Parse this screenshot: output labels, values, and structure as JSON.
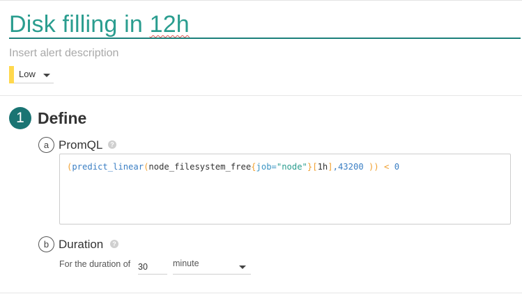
{
  "alert": {
    "title_prefix": "Disk filling in ",
    "title_misspelled": "12h",
    "description_placeholder": "Insert alert description",
    "severity": {
      "label": "Low",
      "color": "#ffd84d"
    }
  },
  "define": {
    "step_number": "1",
    "title": "Define",
    "promql": {
      "letter": "a",
      "title": "PromQL",
      "help_icon": "?",
      "query": "(predict_linear(node_filesystem_free{job=\"node\"}[1h],43200 )) < 0",
      "tokens": {
        "open_paren": "(",
        "function": "predict_linear",
        "open_paren2": "(",
        "metric": "node_filesystem_free",
        "open_brace": "{",
        "label_key": "job",
        "equals": "=",
        "label_value": "\"node\"",
        "close_brace": "}",
        "open_bracket": "[",
        "range": "1h",
        "close_bracket": "]",
        "comma": ",",
        "number": "43200",
        "close_parens": " )) ",
        "operator": "<",
        "threshold": " 0"
      }
    },
    "duration": {
      "letter": "b",
      "title": "Duration",
      "help_icon": "?",
      "prefix_label": "For the duration of",
      "value": "30",
      "unit": "minute"
    }
  },
  "colors": {
    "accent": "#2a9d8f",
    "step_circle": "#1a7473",
    "severity_low": "#ffd84d"
  }
}
